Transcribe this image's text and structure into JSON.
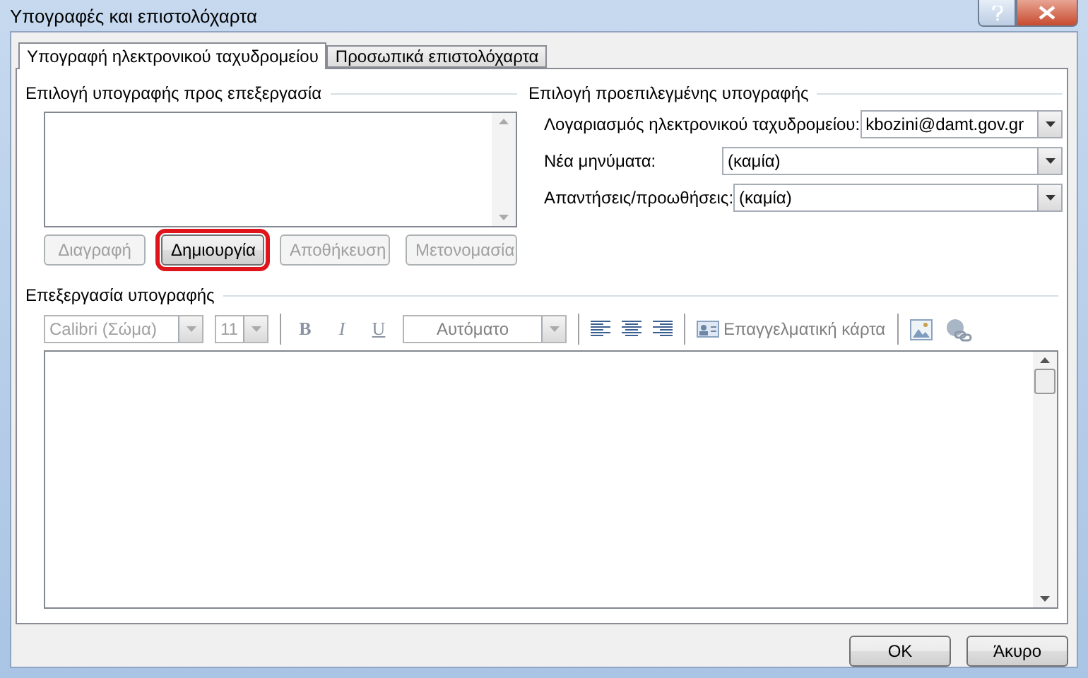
{
  "window": {
    "title": "Υπογραφές και επιστολόχαρτα"
  },
  "tabs": [
    {
      "label": "Υπογραφή ηλεκτρονικού ταχυδρομείου",
      "selected": true
    },
    {
      "label": "Προσωπικά επιστολόχαρτα",
      "selected": false
    }
  ],
  "signature_list": {
    "title": "Επιλογή υπογραφής προς επεξεργασία",
    "buttons": [
      {
        "label": "Διαγραφή",
        "disabled": true,
        "highlighted": false
      },
      {
        "label": "Δημιουργία",
        "disabled": false,
        "highlighted": true
      },
      {
        "label": "Αποθήκευση",
        "disabled": true,
        "highlighted": false
      },
      {
        "label": "Μετονομασία",
        "disabled": true,
        "highlighted": false
      }
    ]
  },
  "default_signature": {
    "title": "Επιλογή προεπιλεγμένης υπογραφής",
    "fields": [
      {
        "label": "Λογαριασμός ηλεκτρονικού ταχυδρομείου:",
        "value": "kbozini@damt.gov.gr",
        "kind": "short"
      },
      {
        "label": "Νέα μηνύματα:",
        "value": "(καμία)",
        "kind": "wide"
      },
      {
        "label": "Απαντήσεις/προωθήσεις:",
        "value": "(καμία)",
        "kind": "wide"
      }
    ]
  },
  "editor": {
    "title": "Επεξεργασία υπογραφής",
    "font": "Calibri (Σώμα)",
    "size": "11",
    "disabled": true,
    "format_buttons": [
      "B",
      "I",
      "U"
    ],
    "color_label": "Αυτόματο",
    "business_card": "Επαγγελματική κάρτα"
  },
  "buttons": [
    "OK",
    "Άκυρο"
  ]
}
